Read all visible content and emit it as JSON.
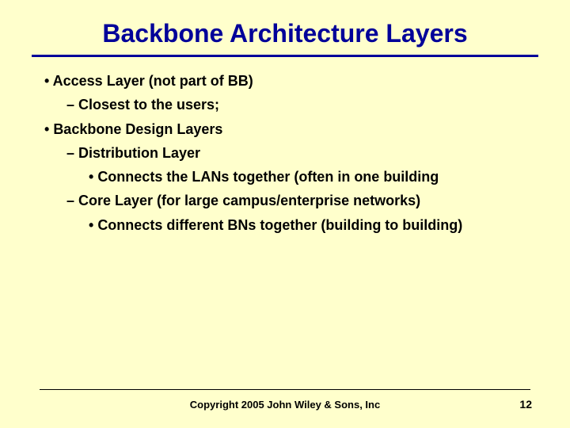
{
  "title": "Backbone Architecture Layers",
  "bullets": {
    "l1a": "Access Layer (not part of BB)",
    "l2a": "Closest to the users;",
    "l1b": "Backbone Design Layers",
    "l2b": "Distribution Layer",
    "l3a": "Connects the LANs together (often in one building",
    "l2c": "Core Layer (for large campus/enterprise networks)",
    "l3b": "Connects different BNs together (building to building)"
  },
  "footer": {
    "copyright": "Copyright 2005 John Wiley & Sons, Inc",
    "page": "12"
  }
}
